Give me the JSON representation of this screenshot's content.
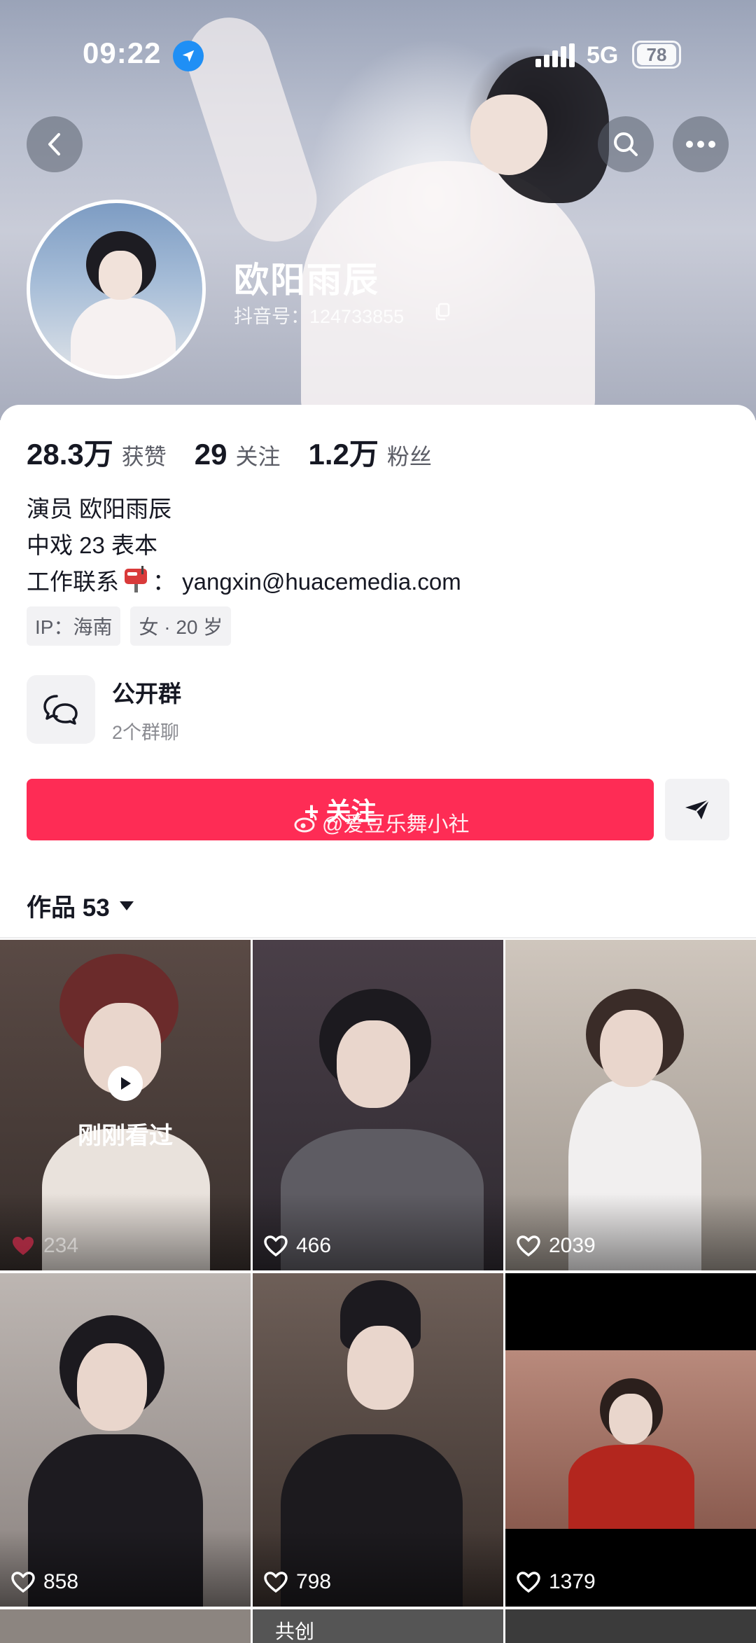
{
  "status_bar": {
    "time": "09:22",
    "network": "5G",
    "battery": "78"
  },
  "profile": {
    "name": "欧阳雨辰",
    "douyin_id": "抖音号：124733855"
  },
  "stats": [
    {
      "value": "28.3万",
      "label": "获赞"
    },
    {
      "value": "29",
      "label": "关注"
    },
    {
      "value": "1.2万",
      "label": "粉丝"
    }
  ],
  "bio": {
    "line1": "演员 欧阳雨辰",
    "line2": "中戏 23 表本",
    "line3_prefix": "工作联系",
    "line3_suffix": "： yangxin@huacemedia.com"
  },
  "tags": [
    "IP：海南",
    "女 · 20 岁"
  ],
  "group": {
    "title": "公开群",
    "subtitle": "2个群聊"
  },
  "follow_button": {
    "label": "+ 关注"
  },
  "watermark": "@爱豆乐舞小社",
  "works": {
    "label": "作品 53"
  },
  "videos": [
    {
      "likes": "234",
      "overlay": "刚刚看过"
    },
    {
      "likes": "466"
    },
    {
      "likes": "2039"
    },
    {
      "likes": "858"
    },
    {
      "likes": "798"
    },
    {
      "likes": "1379"
    },
    {
      "label": ""
    },
    {
      "label": "共创"
    },
    {
      "label": ""
    }
  ],
  "colors": {
    "accent": "#fe2c55",
    "text": "#161823",
    "muted": "#5b5d66"
  }
}
